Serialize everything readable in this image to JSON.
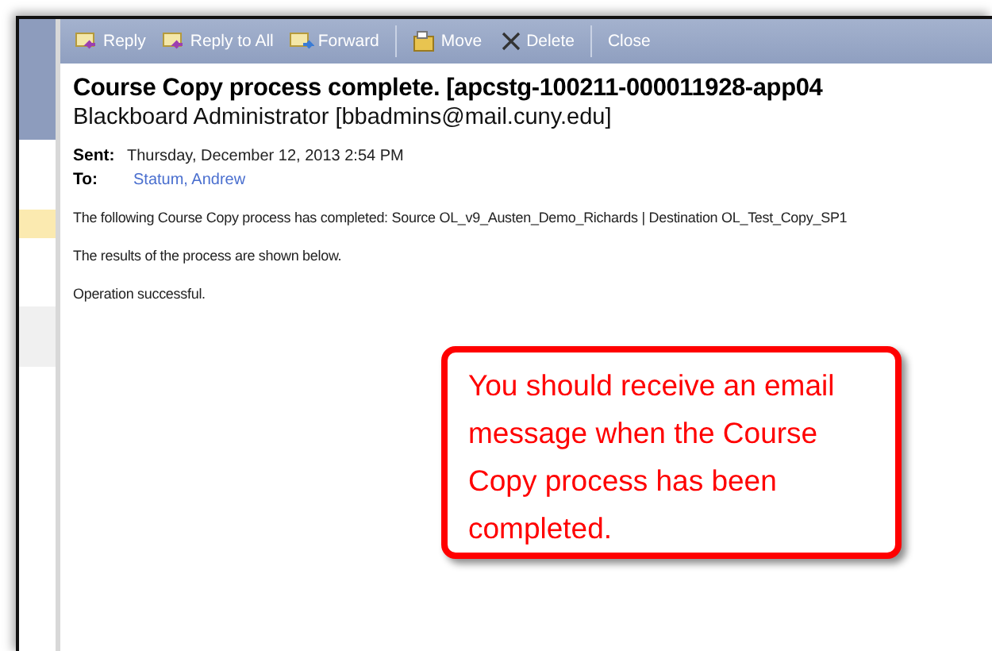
{
  "toolbar": {
    "items": [
      {
        "kind": "button",
        "label": "Reply"
      },
      {
        "kind": "button",
        "label": "Reply to All"
      },
      {
        "kind": "button",
        "label": "Forward"
      },
      {
        "kind": "separator"
      },
      {
        "kind": "button",
        "label": "Move"
      },
      {
        "kind": "button",
        "label": "Delete"
      },
      {
        "kind": "separator"
      },
      {
        "kind": "button",
        "label": "Close"
      }
    ]
  },
  "message": {
    "subject": "Course Copy process complete. [apcstg-100211-000011928-app04",
    "sender": "Blackboard Administrator [bbadmins@mail.cuny.edu]",
    "sent_label": "Sent:",
    "sent": "Thursday, December 12, 2013 2:54 PM",
    "to_label": "To:",
    "to": "Statum, Andrew",
    "body": [
      "The following Course Copy process has completed: Source OL_v9_Austen_Demo_Richards | Destination OL_Test_Copy_SP1",
      "The results of the process are shown below.",
      "Operation successful."
    ]
  },
  "callout": {
    "text": "You should receive an email message when the Course Copy process has been completed."
  }
}
